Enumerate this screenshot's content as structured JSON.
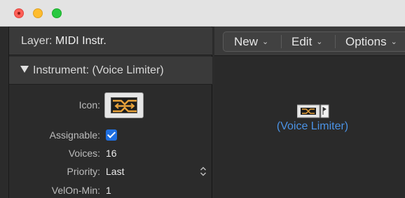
{
  "window": {
    "controls": [
      "close",
      "minimize",
      "zoom"
    ]
  },
  "inspector": {
    "layer_label": "Layer:",
    "layer_value": "MIDI Instr.",
    "instrument_label": "Instrument:",
    "instrument_value": "(Voice Limiter)",
    "properties": {
      "icon_label": "Icon:",
      "assignable_label": "Assignable:",
      "assignable_checked": true,
      "voices_label": "Voices:",
      "voices_value": "16",
      "priority_label": "Priority:",
      "priority_value": "Last",
      "velon_min_label": "VelOn-Min:",
      "velon_min_value": "1"
    }
  },
  "toolbar": {
    "new_label": "New",
    "edit_label": "Edit",
    "options_label": "Options"
  },
  "canvas": {
    "object_label": "(Voice Limiter)",
    "object_label_color": "#4b93e6"
  },
  "icons": {
    "instrument_icon": "voice-limiter-icon",
    "checkbox": "checkmark-icon",
    "stepper": "up-down-stepper-icon",
    "chevron": "chevron-down-icon",
    "disclosure": "disclosure-triangle-icon"
  },
  "colors": {
    "accent": "#1f6fe0",
    "icon_orange": "#e8a23a"
  }
}
